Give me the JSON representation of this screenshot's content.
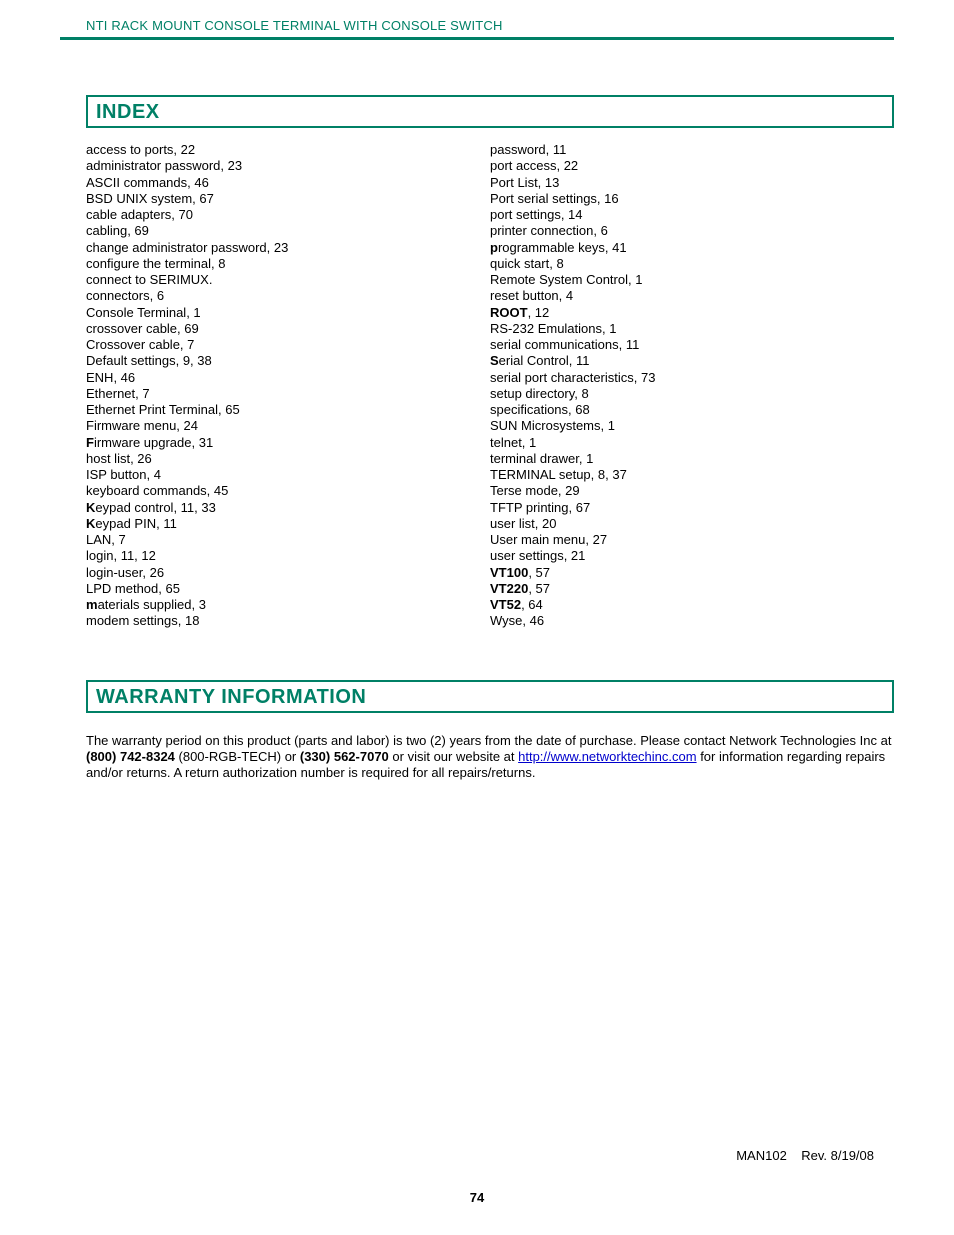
{
  "header": {
    "title": "NTI RACK MOUNT CONSOLE TERMINAL WITH CONSOLE SWITCH"
  },
  "sections": {
    "index_title": "INDEX",
    "warranty_title": "WARRANTY INFORMATION"
  },
  "index_left": [
    {
      "t": "access to ports, 22"
    },
    {
      "t": "administrator password, 23"
    },
    {
      "t": "ASCII commands, 46"
    },
    {
      "t": "BSD UNIX system, 67"
    },
    {
      "t": "cable adapters, 70"
    },
    {
      "t": "cabling, 69"
    },
    {
      "t": "change administrator password, 23"
    },
    {
      "t": "configure the terminal, 8"
    },
    {
      "t": "connect to SERIMUX."
    },
    {
      "t": "connectors, 6"
    },
    {
      "t": "Console Terminal, 1"
    },
    {
      "t": "crossover cable, 69"
    },
    {
      "t": "Crossover cable, 7"
    },
    {
      "t": "Default settings, 9, 38"
    },
    {
      "t": "ENH, 46"
    },
    {
      "t": "Ethernet, 7"
    },
    {
      "t": "Ethernet Print Terminal, 65"
    },
    {
      "t": "Firmware menu, 24"
    },
    {
      "b": "F",
      "t": "irmware upgrade, 31"
    },
    {
      "t": "host list, 26"
    },
    {
      "t": "ISP button, 4"
    },
    {
      "t": "keyboard commands, 45"
    },
    {
      "b": "K",
      "t": "eypad control, 11, 33"
    },
    {
      "b": "K",
      "t": "eypad PIN, 11"
    },
    {
      "t": "LAN, 7"
    },
    {
      "t": "login, 11, 12"
    },
    {
      "t": "login-user, 26"
    },
    {
      "t": "LPD method, 65"
    },
    {
      "b": "m",
      "t": "aterials supplied, 3"
    },
    {
      "t": "modem settings, 18"
    }
  ],
  "index_right": [
    {
      "t": "password, 11"
    },
    {
      "t": "port access, 22"
    },
    {
      "t": "Port List, 13"
    },
    {
      "t": "Port serial settings, 16"
    },
    {
      "t": "port settings, 14"
    },
    {
      "t": "printer connection, 6"
    },
    {
      "b": "p",
      "t": "rogrammable keys, 41"
    },
    {
      "t": "quick start, 8"
    },
    {
      "t": "Remote System Control, 1"
    },
    {
      "t": "reset button, 4"
    },
    {
      "b": "ROOT",
      "t": ", 12"
    },
    {
      "t": "RS-232 Emulations, 1"
    },
    {
      "t": "serial communications, 11"
    },
    {
      "b": "S",
      "t": "erial Control, 11"
    },
    {
      "t": "serial port characteristics, 73"
    },
    {
      "t": "setup directory, 8"
    },
    {
      "t": "specifications, 68"
    },
    {
      "t": "SUN Microsystems, 1"
    },
    {
      "t": "telnet, 1"
    },
    {
      "t": "terminal drawer, 1"
    },
    {
      "t": "TERMINAL setup, 8, 37"
    },
    {
      "t": "Terse mode, 29"
    },
    {
      "t": "TFTP printing, 67"
    },
    {
      "t": "user list, 20"
    },
    {
      "t": "User main menu, 27"
    },
    {
      "t": "user settings, 21"
    },
    {
      "b": "VT100",
      "t": ", 57"
    },
    {
      "b": "VT220",
      "t": ", 57"
    },
    {
      "b": "VT52",
      "t": ", 64"
    },
    {
      "t": "Wyse, 46"
    }
  ],
  "warranty": {
    "p1a": "The warranty period on this product (parts and labor) is two (2) years from the date of purchase.  Please contact Network Technologies Inc at ",
    "ph1": "(800) 742-8324",
    "p1b": "  (800-RGB-TECH) or ",
    "ph2": "(330) 562-7070",
    "p1c": " or visit our website at ",
    "link": "http://www.networktechinc.com",
    "p1d": " for information regarding repairs and/or returns.  A return authorization number is required for all repairs/returns."
  },
  "footer": {
    "doc": "MAN102    Rev. 8/19/08",
    "page": "74"
  }
}
